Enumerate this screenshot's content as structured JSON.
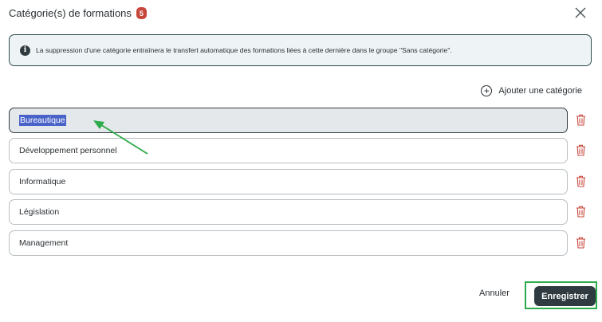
{
  "dialog": {
    "title": "Catégorie(s) de formations",
    "count": "5"
  },
  "info": {
    "message": "La suppression d'une catégorie entraînera le transfert automatique des formations liées à cette dernière dans le groupe \"Sans catégorie\"."
  },
  "add_category_label": "Ajouter une catégorie",
  "categories": [
    {
      "label": "Bureautique",
      "selected": true
    },
    {
      "label": "Développement personnel"
    },
    {
      "label": "Informatique"
    },
    {
      "label": "Législation"
    },
    {
      "label": "Management"
    }
  ],
  "footer": {
    "cancel_label": "Annuler",
    "save_label": "Enregistrer"
  },
  "colors": {
    "badge": "#c8473b",
    "trash": "#c8473b",
    "save_button": "#2f3b40",
    "highlight": "#2cab4a",
    "selection": "#4a63c9"
  },
  "icons": [
    "close-icon",
    "info-icon",
    "plus-circle-icon",
    "trash-icon",
    "annotation-arrow"
  ]
}
